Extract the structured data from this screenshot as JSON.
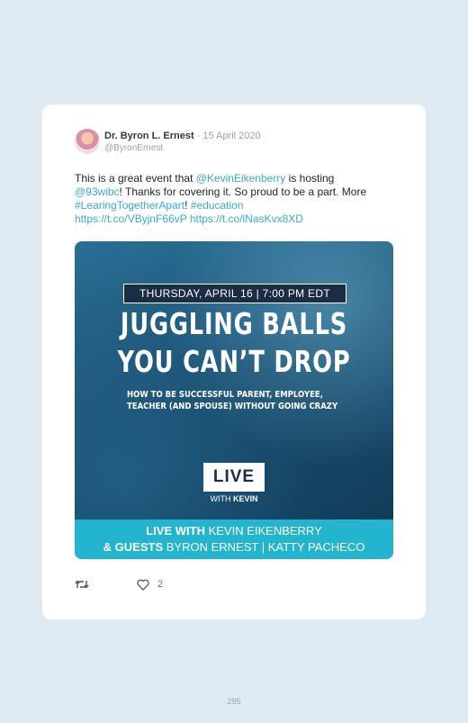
{
  "tweet": {
    "author_name": "Dr. Byron L. Ernest",
    "date": "15 April 2020",
    "date_sep": " · ",
    "handle": "@ByronErnest",
    "text_parts": {
      "t1": "This is a great event that ",
      "mention1": "@KevinEikenberry",
      "t2": " is hosting ",
      "mention2": "@93wibc",
      "t3": "! Thanks for covering it. So proud to be a part. More ",
      "hashtag1": "#LearingTogetherApart",
      "t4": "! ",
      "hashtag2": "#education",
      "link1": "https://t.co/VByjnF66vP",
      "t5": " ",
      "link2": "https://t.co/lNasKvx8XD"
    },
    "like_count": "2"
  },
  "media": {
    "event_date": "THURSDAY, APRIL 16 | 7:00 PM EDT",
    "headline_line1": "JUGGLING BALLS",
    "headline_line2": "YOU CAN’T DROP",
    "subhead_line1": "HOW TO BE SUCCESSFUL PARENT, EMPLOYEE,",
    "subhead_line2": "TEACHER (AND SPOUSE) WITHOUT GOING CRAZY",
    "live_label": "LIVE",
    "live_with": "WITH",
    "live_with_name": "KEVIN",
    "banner": {
      "line1_bold": "LIVE WITH",
      "line1_rest": " KEVIN EIKENBERRY",
      "line2_bold": "& GUESTS",
      "line2_rest": " BYRON ERNEST | KATTY PACHECO"
    }
  },
  "icons": {
    "retweet": "retweet-icon",
    "like": "heart-icon"
  },
  "colors": {
    "link": "#3aa8e0",
    "banner": "#23b4cf",
    "background": "#dfeaf3"
  },
  "page_number": "295"
}
